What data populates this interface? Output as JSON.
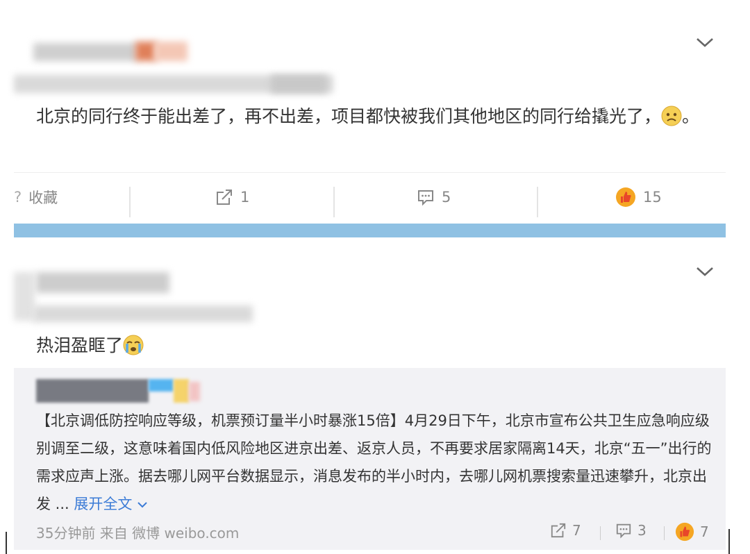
{
  "post1": {
    "text": "北京的同行终于能出差了，再不出差，项目都快被我们其他地区的同行给撬光了，",
    "text_end": "。",
    "actions": {
      "favorite": "收藏",
      "share_count": "1",
      "comment_count": "5",
      "like_count": "15"
    }
  },
  "post2": {
    "text": "热泪盈眶了",
    "repost": {
      "body": "【北京调低防控响应等级，机票预订量半小时暴涨15倍】4月29日下午，北京市宣布公共卫生应急响应级别调至二级，这意味着国内低风险地区进京出差、返京人员，不再要求居家隔离14天，北京“五一”出行的需求应声上涨。据去哪儿网平台数据显示，消息发布的半小时内，去哪儿网机票搜索量迅速攀升，北京出发 ...",
      "expand": "展开全文",
      "meta": "35分钟前 来自 微博 weibo.com",
      "share_count": "7",
      "comment_count": "3",
      "like_count": "7"
    }
  },
  "icons": [
    "chevron-down-icon",
    "share-icon",
    "comment-icon",
    "like-icon",
    "sad-emoji-icon",
    "crying-emoji-icon"
  ],
  "colors": {
    "divider": "#8fc1e3",
    "link": "#3b7bd6",
    "like": "#f07a2e",
    "repost_bg": "#f2f2f5"
  }
}
